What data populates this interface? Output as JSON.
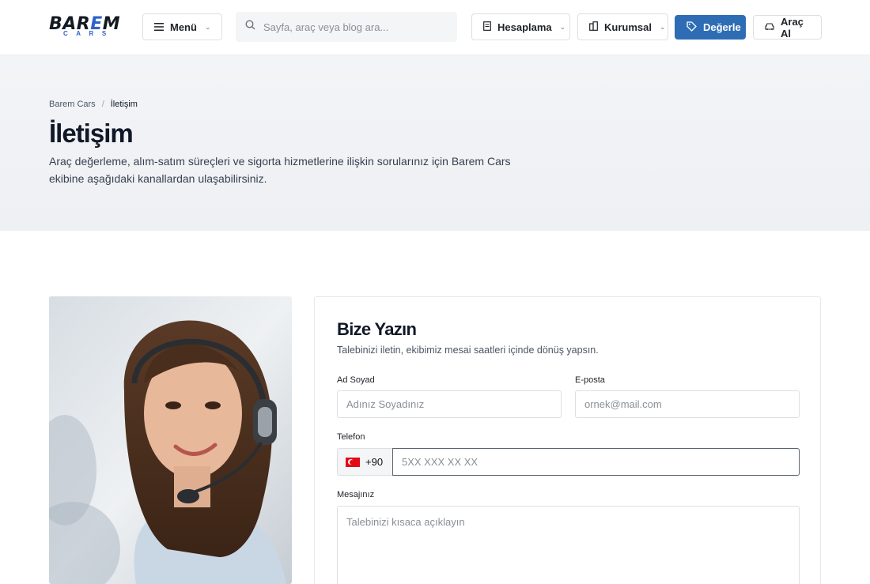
{
  "header": {
    "logo_main_a": "BAR",
    "logo_main_accent": "E",
    "logo_main_b": "M",
    "logo_sub": "CARS",
    "menu_label": "Menü",
    "search_placeholder": "Sayfa, araç veya blog ara...",
    "hesaplama_label": "Hesaplama",
    "kurumsal_label": "Kurumsal",
    "degerle_label": "Değerle",
    "arac_al_label": "Araç Al"
  },
  "breadcrumb": {
    "home": "Barem Cars",
    "separator": "/",
    "current": "İletişim"
  },
  "hero": {
    "title": "İletişim",
    "description": "Araç değerleme, alım-satım süreçleri ve sigorta hizmetlerine ilişkin sorularınız için Barem Cars ekibine aşağıdaki kanallardan ulaşabilirsiniz."
  },
  "form": {
    "title": "Bize Yazın",
    "subtitle": "Talebinizi iletin, ekibimiz mesai saatleri içinde dönüş yapsın.",
    "name_label": "Ad Soyad",
    "name_placeholder": "Adınız Soyadınız",
    "email_label": "E-posta",
    "email_placeholder": "ornek@mail.com",
    "phone_label": "Telefon",
    "country_code": "+90",
    "phone_placeholder": "5XX XXX XX XX",
    "message_label": "Mesajınız",
    "message_placeholder": "Talebinizi kısaca açıklayın"
  },
  "colors": {
    "brand_blue": "#2e6db4",
    "logo_blue": "#2d63c8",
    "hero_bg": "#f2f4f7"
  },
  "icons": {
    "menu": "hamburger-icon",
    "search": "search-icon",
    "hesaplama": "document-icon",
    "kurumsal": "building-icon",
    "degerle": "tag-icon",
    "arac_al": "car-icon",
    "chevron": "chevron-down-icon"
  }
}
